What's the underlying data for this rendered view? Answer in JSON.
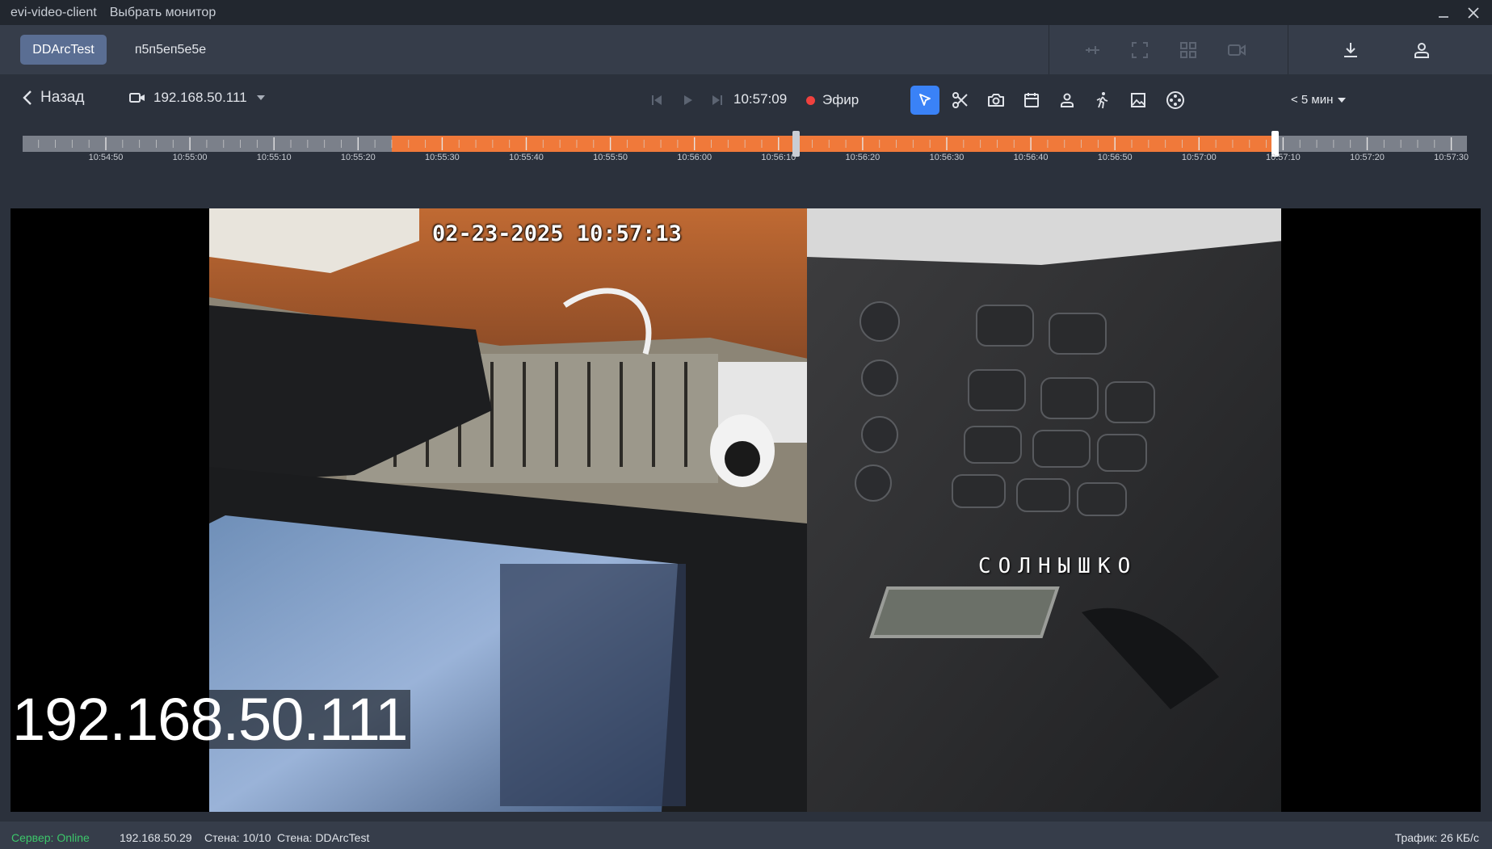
{
  "window": {
    "app_name": "evi-video-client",
    "menu_select_monitor": "Выбрать монитор"
  },
  "tabs": [
    {
      "label": "DDArcTest",
      "active": true
    },
    {
      "label": "п5п5еп5е5е",
      "active": false
    }
  ],
  "controls": {
    "back_label": "Назад",
    "camera": "192.168.50.111",
    "current_time": "10:57:09",
    "live_label": "Эфир",
    "range_label": "< 5 мин",
    "active_tool": "pointer"
  },
  "timeline": {
    "labels": [
      "10:54:50",
      "10:55:00",
      "10:55:10",
      "10:55:20",
      "10:55:30",
      "10:55:40",
      "10:55:50",
      "10:56:00",
      "10:56:10",
      "10:56:20",
      "10:56:30",
      "10:56:40",
      "10:56:50",
      "10:57:00",
      "10:57:10",
      "10:57:20",
      "10:57:30"
    ],
    "selection_start": "10:55:24",
    "selection_end": "10:57:09",
    "cursor_time": "10:56:12",
    "colors": {
      "selection": "#f0793a",
      "track": "#7b808a"
    }
  },
  "video": {
    "osd_timestamp": "02-23-2025 10:57:13",
    "osd_camera_name": "СОЛНЫШКО",
    "ip_overlay": "192.168.50.111"
  },
  "status": {
    "server": "Сервер: Online",
    "ip": "192.168.50.29",
    "wall_count": "Стена: 10/10",
    "wall_name": "Стена: DDArcTest",
    "traffic": "Трафик: 26 КБ/с"
  },
  "colors": {
    "accent": "#3a82f7",
    "online": "#3cc66a",
    "live_dot": "#f0413e",
    "tab_active": "#5a6e93"
  }
}
